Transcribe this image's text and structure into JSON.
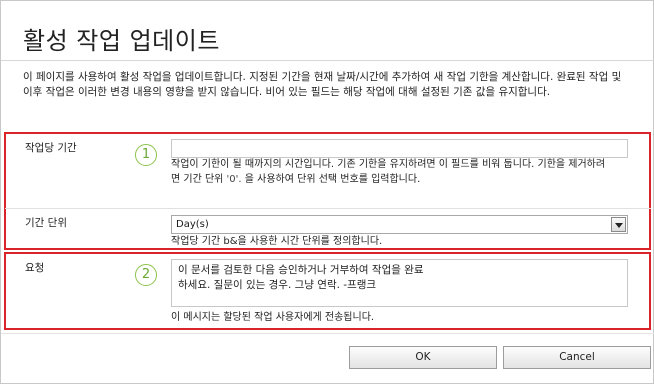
{
  "dialog": {
    "title": "활성 작업 업데이트",
    "intro": "이 페이지를 사용하여 활성 작업을 업데이트합니다. 지정된 기간을 현재 날짜/시간에 추가하여 새 작업 기한을 계산합니다. 완료된 작업 및 이후 작업은 이러한 변경 내용의 영향을 받지 않습니다. 비어 있는 필드는 해당 작업에 대해 설정된 기존 값을 유지합니다."
  },
  "duration": {
    "label": "작업당 기간",
    "marker": "1",
    "value": "",
    "help_part1": "작업이 기한이 될 때까지의 시간입니다. 기존 기한을 유지하려면 이 필드를 비워 둡니다. 기한을 제거하려면 기간 단위",
    "help_code": "'0'.",
    "help_part2": "을 사용하여 단위 선택 번호를 입력합니다."
  },
  "duration_unit": {
    "label": "기간 단위",
    "selected": "Day(s)",
    "help": "작업당 기간 b&을 사용한 시간 단위를 정의합니다."
  },
  "request": {
    "label": "요청",
    "marker": "2",
    "value": "이 문서를 검토한 다음 승인하거나 거부하여 작업을 완료\n하세요. 질문이 있는 경우. 그냥 연락. -프랭크",
    "help": "이 메시지는 할당된 작업 사용자에게 전송됩니다."
  },
  "buttons": {
    "ok": "OK",
    "cancel": "Cancel"
  },
  "colors": {
    "highlight_border": "#d9252a",
    "marker_green": "#8bc34a"
  }
}
